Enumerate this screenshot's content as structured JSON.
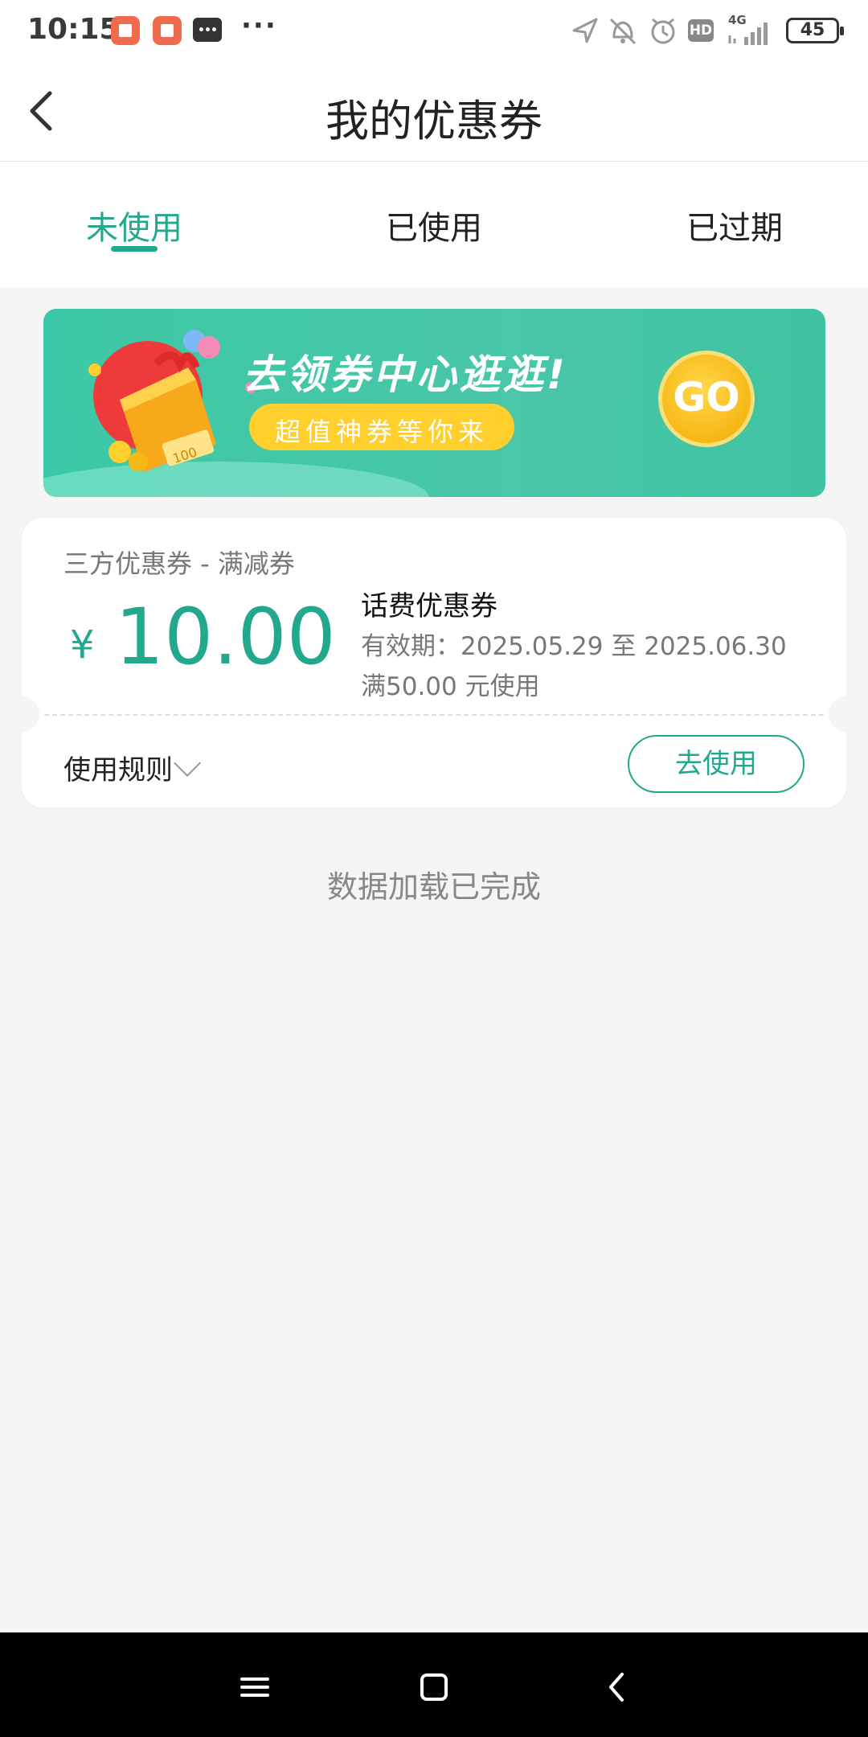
{
  "status_bar": {
    "time": "10:15",
    "network": "4G",
    "battery": "45",
    "hd_label": "HD",
    "more": "···"
  },
  "header": {
    "title": "我的优惠券"
  },
  "tabs": [
    {
      "label": "未使用",
      "active": true
    },
    {
      "label": "已使用",
      "active": false
    },
    {
      "label": "已过期",
      "active": false
    }
  ],
  "banner": {
    "headline": "去领券中心逛逛!",
    "subtext": "超值神券等你来",
    "go_label": "GO",
    "gift_tag": "100"
  },
  "coupon": {
    "type": "三方优惠券 - 满减券",
    "currency": "¥",
    "amount": "10.00",
    "name": "话费优惠券",
    "validity": "有效期：2025.05.29 至 2025.06.30",
    "condition": "满50.00 元使用",
    "rules_label": "使用规则",
    "use_button": "去使用"
  },
  "footer": {
    "load_status": "数据加载已完成"
  },
  "colors": {
    "accent": "#22a88d",
    "banner": "#49c7a8",
    "go": "#f7b715"
  }
}
